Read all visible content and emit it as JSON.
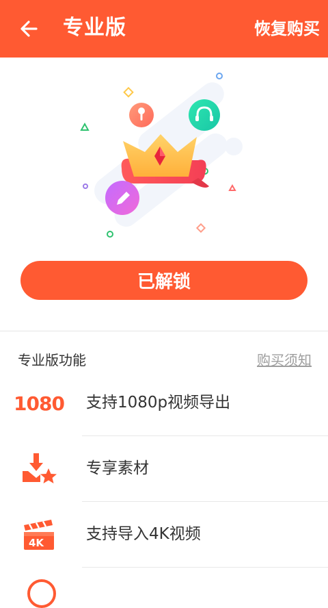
{
  "header": {
    "title": "专业版",
    "restore_label": "恢复购买"
  },
  "unlock_button": {
    "label": "已解锁"
  },
  "section": {
    "title": "专业版功能",
    "notice_label": "购买须知"
  },
  "features": [
    {
      "label": "支持1080p视频导出",
      "icon_text": "1080",
      "icon": "1080p-icon"
    },
    {
      "label": "专享素材",
      "icon": "download-star-icon"
    },
    {
      "label": "支持导入4K视频",
      "icon_text": "4K",
      "icon": "clapperboard-4k-icon"
    }
  ],
  "colors": {
    "accent": "#FF5A32",
    "text": "#333333",
    "muted": "#9E9E9E"
  }
}
